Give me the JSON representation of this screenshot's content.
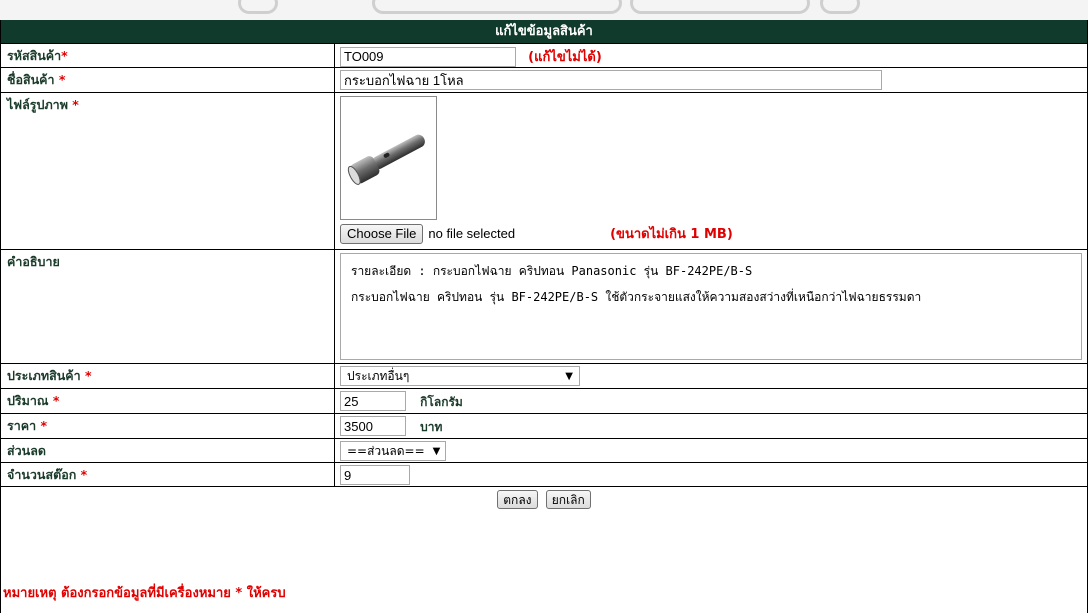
{
  "form": {
    "title": "แก้ไขข้อมูลสินค้า",
    "fields": {
      "product_code": {
        "label": "รหัสสินค้า",
        "required_mark": "*",
        "value": "TO009",
        "note": "(แก้ไขไม่ได้)"
      },
      "product_name": {
        "label": "ชื่อสินค้า ",
        "required_mark": "*",
        "value": "กระบอกไฟฉาย 1โหล"
      },
      "image_file": {
        "label": "ไฟล์รูปภาพ ",
        "required_mark": "*",
        "button_label": "Choose File",
        "status": "no file selected",
        "note": "(ขนาดไม่เกิน 1 MB)",
        "image_icon": "flashlight-image"
      },
      "description": {
        "label": "คำอธิบาย",
        "value": "รายละเอียด : กระบอกไฟฉาย คริปทอน Panasonic รุ่น BF-242PE/B-S\nกระบอกไฟฉาย คริปทอน รุ่น BF-242PE/B-S ใช้ตัวกระจายแสงให้ความสองสว่างที่เหนือกว่าไฟฉายธรรมดา"
      },
      "category": {
        "label": "ประเภทสินค้า ",
        "required_mark": "*",
        "selected": "ประเภทอื่นๆ"
      },
      "quantity": {
        "label": "ปริมาณ ",
        "required_mark": "*",
        "value": "25",
        "unit": "กิโลกรัม"
      },
      "price": {
        "label": "ราคา ",
        "required_mark": "*",
        "value": "3500",
        "unit": "บาท"
      },
      "discount": {
        "label": "ส่วนลด",
        "selected": "==ส่วนลด=="
      },
      "stock": {
        "label": "จำนวนสต๊อก ",
        "required_mark": "*",
        "value": "9"
      }
    },
    "buttons": {
      "ok": "ตกลง",
      "cancel": "ยกเลิก"
    },
    "footnote": "หมายเหตุ ต้องกรอกข้อมูลที่มีเครื่องหมาย * ให้ครบ"
  },
  "colors": {
    "header_bg": "#0f3a2c",
    "required": "#e00000"
  }
}
